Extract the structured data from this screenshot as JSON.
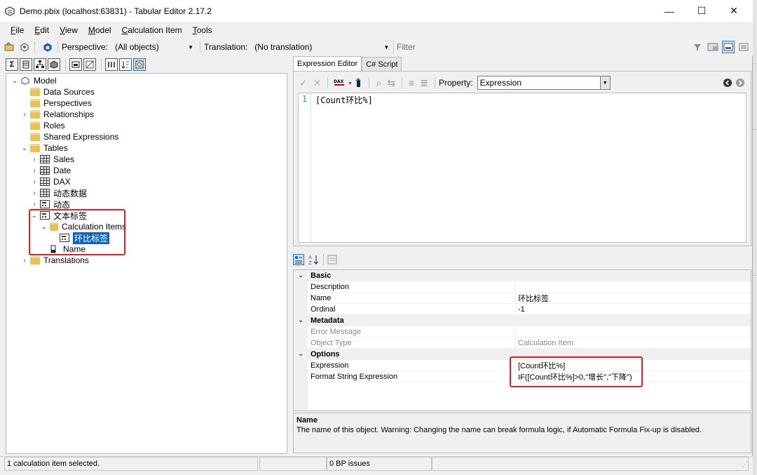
{
  "window": {
    "title": "Demo.pbix (localhost:63831) - Tabular Editor 2.17.2",
    "minimize": "—",
    "maximize": "☐",
    "close": "✕"
  },
  "menu": {
    "items": [
      {
        "pre": "",
        "u": "F",
        "post": "ile"
      },
      {
        "pre": "",
        "u": "E",
        "post": "dit"
      },
      {
        "pre": "",
        "u": "V",
        "post": "iew"
      },
      {
        "pre": "",
        "u": "M",
        "post": "odel"
      },
      {
        "pre": "",
        "u": "C",
        "post": "alculation Item"
      },
      {
        "pre": "",
        "u": "T",
        "post": "ools"
      }
    ]
  },
  "toolbar": {
    "perspective_label": "Perspective:",
    "perspective_value": "(All objects)",
    "translation_label": "Translation:",
    "translation_value": "(No translation)",
    "filter_placeholder": "Filter"
  },
  "tree": {
    "model": "Model",
    "data_sources": "Data Sources",
    "perspectives": "Perspectives",
    "relationships": "Relationships",
    "roles": "Roles",
    "shared_expressions": "Shared Expressions",
    "tables": "Tables",
    "sales": "Sales",
    "date": "Date",
    "dax": "DAX",
    "dyn_data": "动态数据",
    "dyn": "动态",
    "text_label": "文本标签",
    "calc_items": "Calculation Items",
    "selected_item": "环比标签",
    "name_col": "Name",
    "translations": "Translations"
  },
  "editor": {
    "tab_expression": "Expression Editor",
    "tab_csharp": "C# Script",
    "property_label": "Property:",
    "property_value": "Expression",
    "line_no": "1",
    "code": "[Count环比%]"
  },
  "properties": {
    "cat_basic": "Basic",
    "description": "Description",
    "name_label": "Name",
    "name_value": "环比标签",
    "ordinal_label": "Ordinal",
    "ordinal_value": "-1",
    "cat_metadata": "Metadata",
    "error_message": "Error Message",
    "object_type_label": "Object Type",
    "object_type_value": "Calculation Item",
    "cat_options": "Options",
    "expression_label": "Expression",
    "expression_value": "[Count环比%]",
    "format_label": "Format String Expression",
    "format_value": "IF([Count环比%]>0,\"增长\",\"下降\")"
  },
  "help": {
    "title": "Name",
    "body": "The name of this object. Warning: Changing the name can break formula logic, if Automatic Formula Fix-up is disabled."
  },
  "status": {
    "left": "1 calculation item selected.",
    "mid": "0 BP issues"
  },
  "colors": {
    "selection": "#0a64c8",
    "highlight_box": "#e02020"
  }
}
